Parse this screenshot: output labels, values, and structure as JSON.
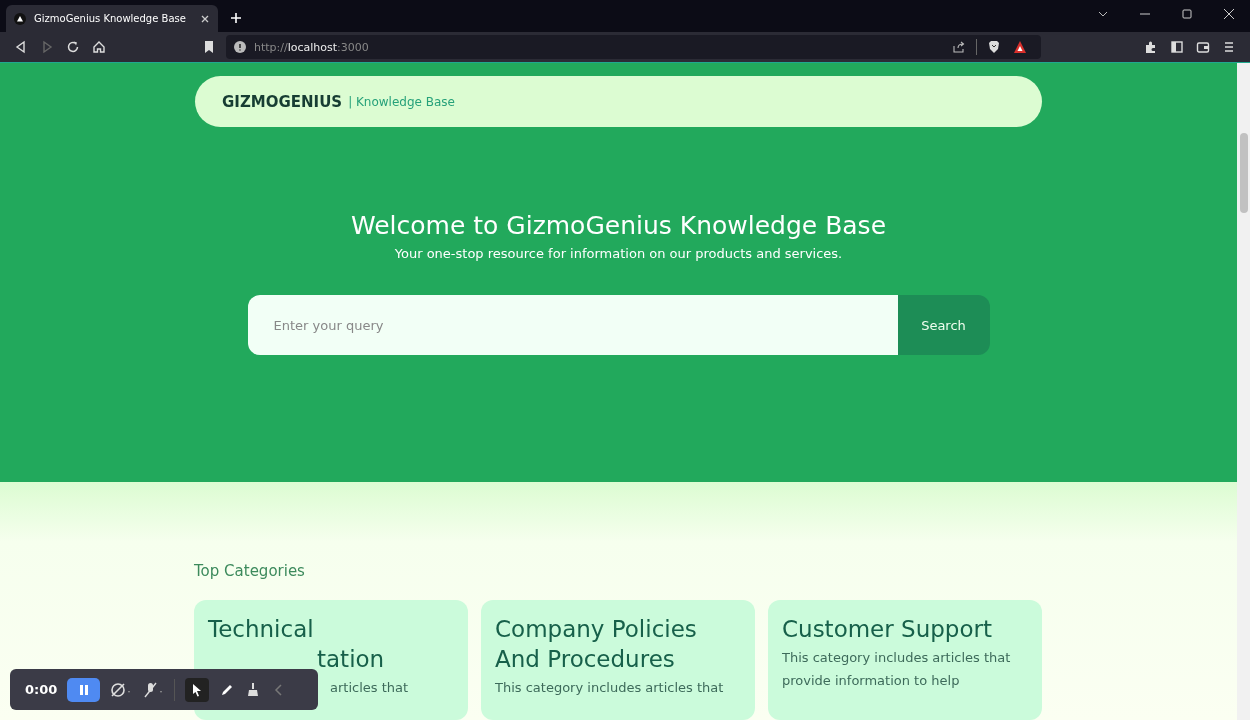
{
  "browser": {
    "tab": {
      "title": "GizmoGenius Knowledge Base",
      "selected": true
    },
    "address": {
      "scheme": "http://",
      "host": "localhost",
      "port": ":3000"
    }
  },
  "header": {
    "brand": "GIZMOGENIUS",
    "subtitle": "| Knowledge Base"
  },
  "hero": {
    "title": "Welcome to GizmoGenius Knowledge Base",
    "tagline": "Your one-stop resource for information on our products and services.",
    "search": {
      "placeholder": "Enter your query",
      "button": "Search"
    }
  },
  "categories": {
    "heading": "Top Categories",
    "items": [
      {
        "title_lines": [
          "Technical",
          "tation"
        ],
        "description": "articles that"
      },
      {
        "title_lines": [
          "Company Policies",
          "And Procedures"
        ],
        "description": "This category includes articles that"
      },
      {
        "title_lines": [
          "Customer Support"
        ],
        "description": "This category includes articles that provide information to help"
      }
    ]
  },
  "recorder": {
    "time": "0:00"
  }
}
